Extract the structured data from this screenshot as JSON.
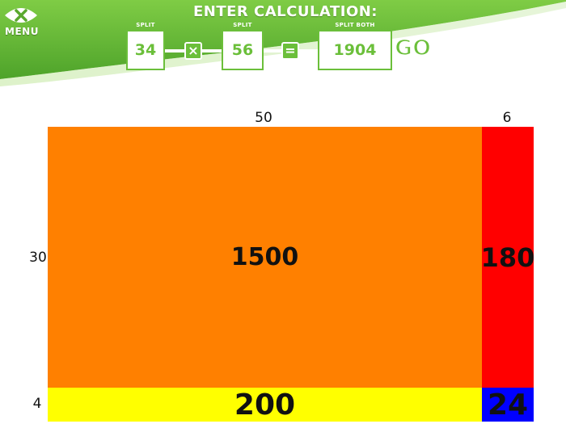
{
  "header": {
    "title": "ENTER CALCULATION:",
    "menu_label": "MENU",
    "go_label": "GO",
    "fields": {
      "left_label": "SPLIT",
      "left_value": "34",
      "operator": "×",
      "right_label": "SPLIT",
      "right_value": "56",
      "equals": "=",
      "result_label": "SPLIT BOTH",
      "result_value": "1904"
    }
  },
  "grid": {
    "columns": [
      "50",
      "6"
    ],
    "rows": [
      "30",
      "4"
    ],
    "cells": {
      "r0c0": "1500",
      "r0c1": "180",
      "r1c0": "200",
      "r1c1": "24"
    }
  },
  "colors": {
    "brand_green": "#6bbf3a",
    "cell_r0c0": "#ff8000",
    "cell_r0c1": "#ff0000",
    "cell_r1c0": "#ffff00",
    "cell_r1c1": "#0000ff"
  }
}
